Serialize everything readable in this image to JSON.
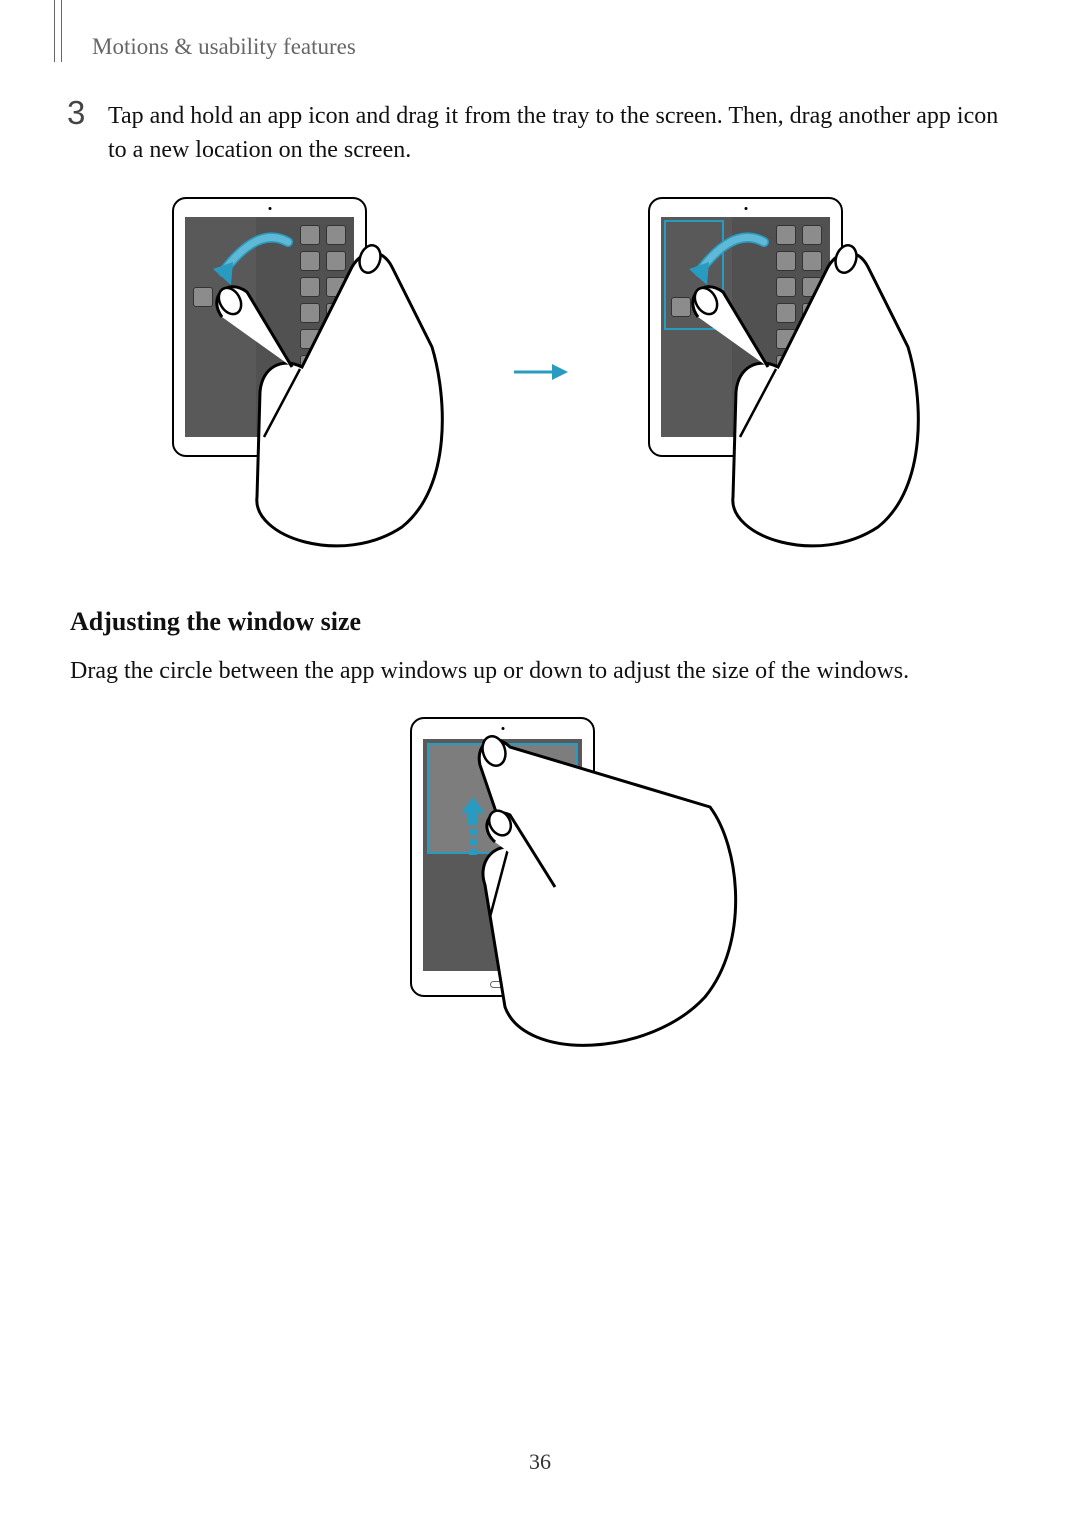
{
  "header": {
    "section": "Motions & usability features"
  },
  "step": {
    "number": "3",
    "text": "Tap and hold an app icon and drag it from the tray to the screen. Then, drag another app icon to a new location on the screen."
  },
  "subsection": {
    "heading": "Adjusting the window size",
    "body": "Drag the circle between the app windows up or down to adjust the size of the windows."
  },
  "page_number": "36",
  "icons": {
    "drag_arrow": "drag-curve-arrow-icon",
    "sequence_arrow": "sequence-arrow-icon",
    "resize_up": "resize-up-arrow-icon",
    "hand": "hand-gesture-icon"
  },
  "colors": {
    "accent": "#2a9bc0"
  }
}
